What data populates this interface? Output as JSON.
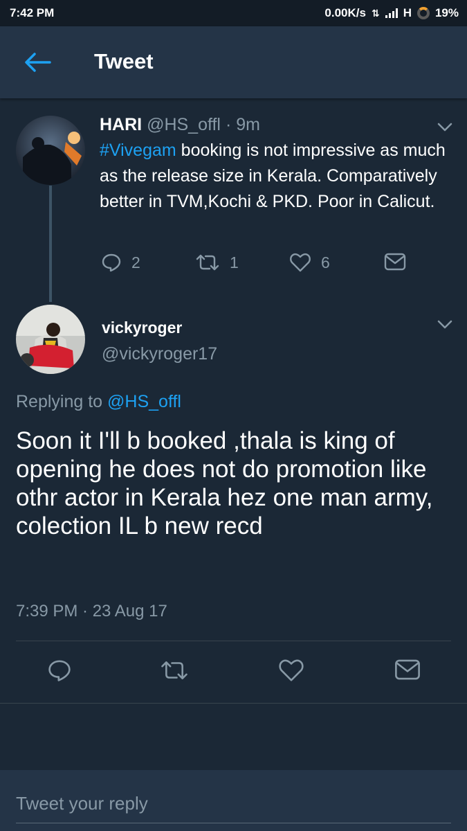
{
  "status_bar": {
    "time": "7:42 PM",
    "net_speed": "0.00K/s",
    "network_type": "H",
    "battery": "19%"
  },
  "header": {
    "title": "Tweet"
  },
  "parent_tweet": {
    "name": "HARI",
    "handle": "@HS_offl",
    "age": "· 9m",
    "hashtag": "#Vivegam",
    "text": " booking is not impressive as much as the release size in Kerala. Comparatively better in TVM,Kochi & PKD. Poor in Calicut.",
    "reply_count": "2",
    "retweet_count": "1",
    "like_count": "6"
  },
  "main_tweet": {
    "name": "vickyroger",
    "handle": "@vickyroger17",
    "replying_prefix": "Replying to ",
    "replying_to": "@HS_offl",
    "text": "Soon it I'll b booked ,thala is king of opening he does not do promotion like othr actor in Kerala hez one man army, colection IL b new recd",
    "timestamp": "7:39 PM · 23 Aug 17"
  },
  "reply_box": {
    "placeholder": "Tweet your reply"
  },
  "colors": {
    "background": "#1b2836",
    "header": "#243447",
    "accent": "#1da1f2",
    "muted": "#8899a6"
  }
}
